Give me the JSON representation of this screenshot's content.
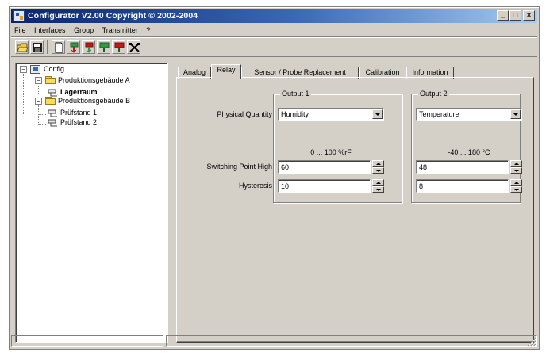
{
  "window": {
    "title": "Configurator  V2.00 Copyright © 2002-2004",
    "caption_buttons": {
      "minimize": "_",
      "maximize": "□",
      "close": "×"
    }
  },
  "menu": [
    "File",
    "Interfaces",
    "Group",
    "Transmitter",
    "?"
  ],
  "toolbar": {
    "buttons": [
      "open-icon",
      "save-icon",
      "new-icon",
      "transmitter-add-icon",
      "transmitter-remove-icon",
      "transmitter-read-icon",
      "transmitter-write-icon",
      "tools-icon"
    ]
  },
  "tree": {
    "root": "Config",
    "groups": [
      {
        "label": "Produktionsgebäude A",
        "children": [
          "Lagerraum"
        ]
      },
      {
        "label": "Produktionsgebäude B",
        "children": [
          "Prüfstand 1",
          "Prüfstand 2"
        ]
      }
    ],
    "selected": "Lagerraum"
  },
  "tabs": [
    "Analog",
    "Relay",
    "Sensor / Probe Replacement",
    "Calibration",
    "Information"
  ],
  "active_tab": "Relay",
  "relay": {
    "labels": {
      "physical_quantity": "Physical Quantity",
      "switching_point_high": "Switching Point High",
      "hysteresis": "Hysteresis"
    },
    "output1": {
      "legend": "Output 1",
      "quantity": "Humidity",
      "range": "0 ... 100 %rF",
      "switching_point_high": "60",
      "hysteresis": "10"
    },
    "output2": {
      "legend": "Output 2",
      "quantity": "Temperature",
      "range": "-40 ... 180 °C",
      "switching_point_high": "48",
      "hysteresis": "8"
    }
  },
  "statusbar": {
    "pane1": "",
    "pane2": ""
  },
  "colors": {
    "face": "#d4d0c8",
    "title_start": "#0a246a",
    "title_end": "#a6caf0",
    "folder": "#f7dd5b"
  }
}
